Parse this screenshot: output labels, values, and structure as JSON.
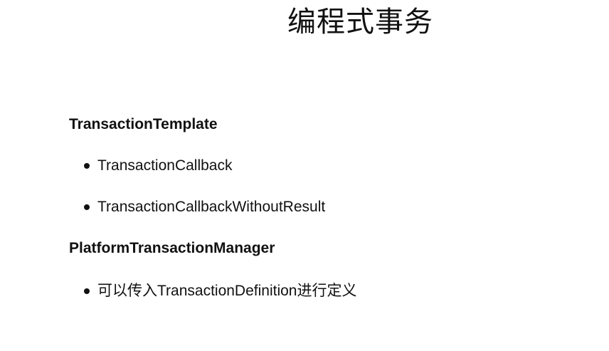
{
  "slide": {
    "title": "编程式事务",
    "sections": [
      {
        "heading": "TransactionTemplate",
        "items": [
          "TransactionCallback",
          "TransactionCallbackWithoutResult"
        ]
      },
      {
        "heading": "PlatformTransactionManager",
        "items": [
          "可以传入TransactionDefinition进行定义"
        ]
      }
    ]
  }
}
